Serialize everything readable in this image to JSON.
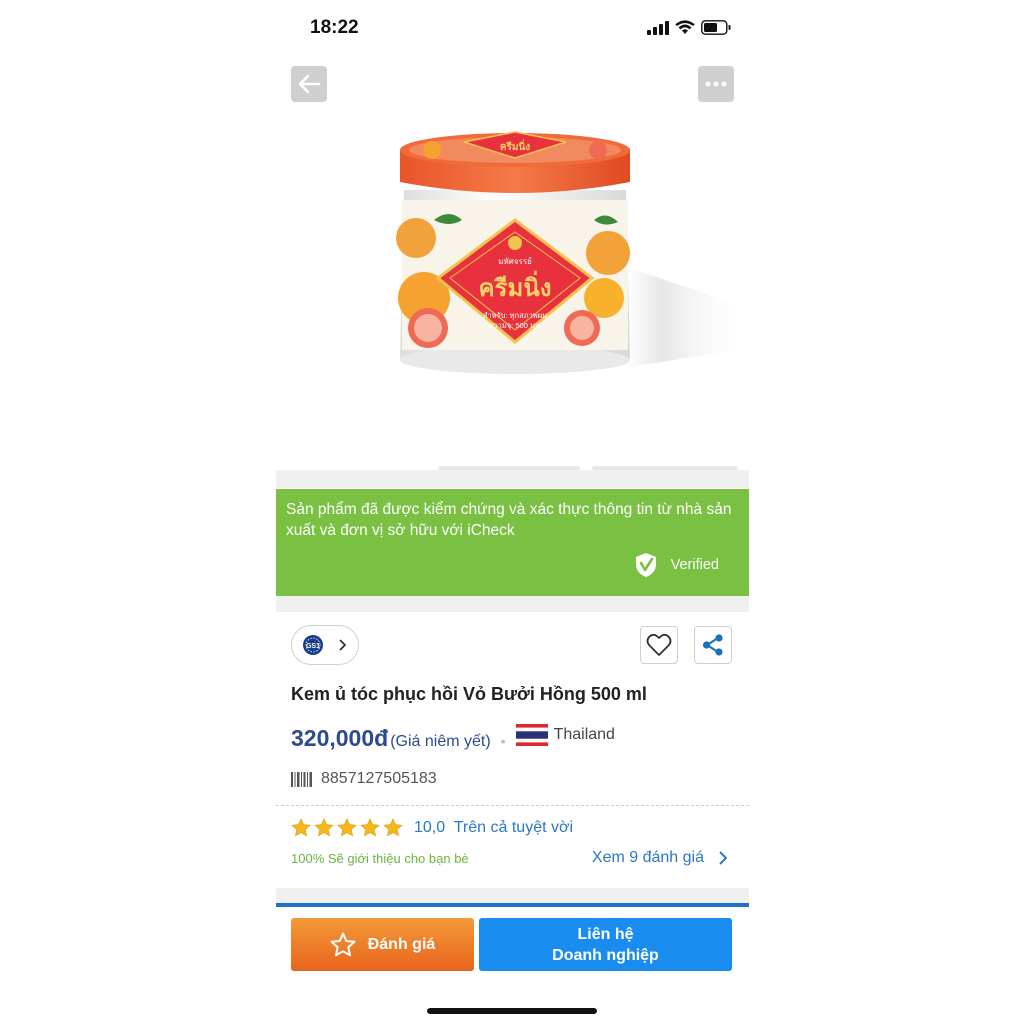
{
  "status": {
    "time": "18:22"
  },
  "product_image": {
    "brand": "มหัศจรรย์",
    "name": "ครีมนิ่ง",
    "line1": "สำหรับ: ทุกสภาพผม",
    "line2": "ความจุ: 500 มล."
  },
  "verified": {
    "message": "Sản phẩm đã được kiểm chứng và xác thực thông tin từ nhà sản xuất và đơn vị sở hữu với iCheck",
    "badge": "Verified"
  },
  "product": {
    "name": "Kem ủ tóc phục hồi Vỏ Bưởi Hồng 500 ml",
    "price": "320,000đ",
    "price_note": "(Giá niêm yết)",
    "country": "Thailand",
    "barcode": "8857127505183"
  },
  "rating": {
    "stars": 5,
    "score": "10,0",
    "label": "Trên cả tuyệt vời",
    "recommend": "100% Sẽ giới thiệu cho bạn bè",
    "see_reviews": "Xem 9 đánh giá"
  },
  "actions": {
    "rate_label": "Đánh giá",
    "contact_line1": "Liên hệ",
    "contact_line2": "Doanh nghiệp"
  },
  "colors": {
    "verified_bg": "#79c043",
    "price": "#2e4a8f",
    "link": "#2a78c8",
    "rate_button": "#ee7b28",
    "contact_button": "#1a8cf0",
    "star": "#f5b81a"
  }
}
